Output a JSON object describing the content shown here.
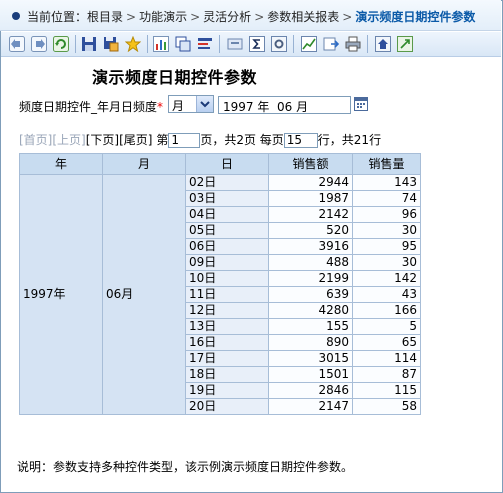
{
  "breadcrumb": {
    "prefix": "当前位置：",
    "items": [
      "根目录",
      "功能演示",
      "灵活分析",
      "参数相关报表"
    ],
    "current": "演示频度日期控件参数"
  },
  "toolbar": {
    "icons": [
      "back-icon",
      "forward-icon",
      "refresh-icon",
      "save-icon",
      "save-as-icon",
      "favorite-icon",
      "chart-icon",
      "copy-icon",
      "filter-icon",
      "print-preview-icon",
      "sum-icon",
      "settings-icon",
      "bar-chart-icon",
      "export-icon",
      "print-icon",
      "home-icon",
      "expand-icon"
    ]
  },
  "report": {
    "title": "演示频度日期控件参数"
  },
  "filter": {
    "label": "频度日期控件_年月日频度",
    "required_mark": "*",
    "frequency": "月",
    "date_value": "1997 年  06 月"
  },
  "pager": {
    "first": "[首页]",
    "prev": "[上页]",
    "next": "[下页]",
    "last": "[尾页]",
    "page_prefix": "第",
    "page_value": "1",
    "page_suffix": "页，共2页 每页",
    "per_page_value": "15",
    "per_page_suffix": "行，共21行"
  },
  "table": {
    "headers": [
      "年",
      "月",
      "日",
      "销售额",
      "销售量"
    ],
    "year": "1997年",
    "month": "06月",
    "rows": [
      [
        "02日",
        "2944",
        "143"
      ],
      [
        "03日",
        "1987",
        "74"
      ],
      [
        "04日",
        "2142",
        "96"
      ],
      [
        "05日",
        "520",
        "30"
      ],
      [
        "06日",
        "3916",
        "95"
      ],
      [
        "09日",
        "488",
        "30"
      ],
      [
        "10日",
        "2199",
        "142"
      ],
      [
        "11日",
        "639",
        "43"
      ],
      [
        "12日",
        "4280",
        "166"
      ],
      [
        "13日",
        "155",
        "5"
      ],
      [
        "16日",
        "890",
        "65"
      ],
      [
        "17日",
        "3015",
        "114"
      ],
      [
        "18日",
        "1501",
        "87"
      ],
      [
        "19日",
        "2846",
        "115"
      ],
      [
        "20日",
        "2147",
        "58"
      ]
    ]
  },
  "note": "说明：参数支持多种控件类型，该示例演示频度日期控件参数。",
  "colors": {
    "accent": "#0b5aa8",
    "header_bg": "#c8dcf0",
    "border": "#a7bdd7"
  }
}
